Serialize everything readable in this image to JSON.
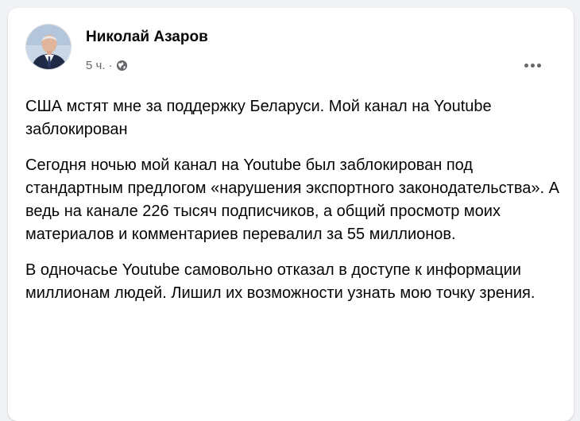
{
  "post": {
    "author": "Николай Азаров",
    "time": "5 ч.",
    "separator": "·",
    "privacy_icon": "globe-icon",
    "more_icon": "more-horizontal-icon",
    "paragraphs": [
      "США мстят мне за поддержку Беларуси. Мой канал на Youtube заблокирован",
      "Сегодня ночью мой канал на Youtube был заблокирован под стандартным предлогом «нарушения экспортного законодательства». А ведь на канале 226 тысяч подписчиков, а общий просмотр моих материалов и комментариев перевалил за 55 миллионов.",
      "В одночасье Youtube самовольно отказал в доступе к информации миллионам людей. Лишил их возможности узнать мою точку зрения."
    ]
  },
  "colors": {
    "page_background": "#f0f2f5",
    "card_background": "#ffffff",
    "primary_text": "#050505",
    "secondary_text": "#65676b"
  }
}
